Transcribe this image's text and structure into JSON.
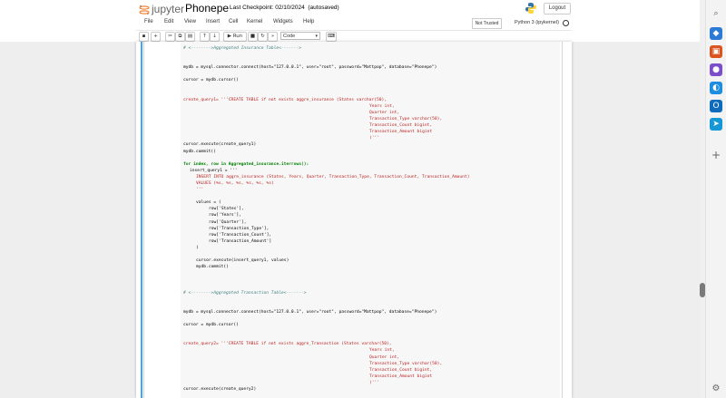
{
  "header": {
    "app_name": "jupyter",
    "notebook_title": "Phonepe",
    "checkpoint": "Last Checkpoint: 02/10/2024",
    "autosave": "(autosaved)",
    "logout_label": "Logout",
    "not_trusted_label": "Not Trusted",
    "kernel_label": "Python 3 (ipykernel)"
  },
  "menu": [
    "File",
    "Edit",
    "View",
    "Insert",
    "Cell",
    "Kernel",
    "Widgets",
    "Help"
  ],
  "toolbar": {
    "run_label": "Run",
    "cell_type": "Code",
    "buttons": [
      "save-icon",
      "add-cell-icon",
      "cut-icon",
      "copy-icon",
      "paste-icon",
      "move-up-icon",
      "move-down-icon",
      "run-icon",
      "stop-icon",
      "restart-icon",
      "restart-run-all-icon",
      "command-palette-icon"
    ]
  },
  "code": {
    "comment_insurance": "# <-------->Aggregated Insurance Table<------->",
    "mydb_connect_1": "mydb = mysql.connector.connect(host=\"127.0.0.1\", user=\"root\", password=\"Mattpop\", database=\"Phonepe\")",
    "cursor_1": "cursor = mydb.cursor()",
    "create_query1_open": "create_query1= '''CREATE TABLE if not exists aggre_insurance (States varchar(50),",
    "create_query1_years": "Years int,",
    "create_query1_quarter": "Quarter int,",
    "create_query1_type": "Transaction_Type varchar(50),",
    "create_query1_count": "Transaction_Count bigint,",
    "create_query1_amount": "Transaction_Amount bigint",
    "create_query1_close": ")'''",
    "execute_create1": "cursor.execute(create_query1)",
    "commit_1": "mydb.commit()",
    "for_loop": "for index, row in Aggregated_insurance.iterrows():",
    "insert_query_open": "insert_query1 = '''",
    "insert_into": "INSERT INTO aggre_insurance (States, Years, Quarter, Transaction_Type, Transaction_Count, Transaction_Amount)",
    "insert_values": "VALUES (%s, %s, %s, %s, %s, %s)",
    "insert_close": "'''",
    "values_open": "values = (",
    "row_states": "row['States'],",
    "row_years": "row['Years'],",
    "row_quarter": "row['Quarter'],",
    "row_type": "row['Transaction_Type'],",
    "row_count": "row['Transaction_Count'],",
    "row_amount": "row['Transaction_Amount']",
    "values_close": ")",
    "execute_insert": "cursor.execute(insert_query1, values)",
    "commit_loop": "mydb.commit()",
    "comment_transaction": "# <-------->Aggregated Transaction Table<------->",
    "mydb_connect_2": "mydb = mysql.connector.connect(host=\"127.0.0.1\", user=\"root\", password=\"Mattpop\", database=\"Phonepe\")",
    "cursor_2": "cursor = mydb.cursor()",
    "create_query2_open": "create_query2= '''CREATE TABLE if not exists aggre_Transaction (States varchar(50),",
    "create_query2_years": "Years int,",
    "create_query2_quarter": "Quarter int,",
    "create_query2_type": "Transaction_Type varchar(50),",
    "create_query2_count": "Transaction_Count bigint,",
    "create_query2_amount": "Transaction_Amount bigint",
    "create_query2_close": ")'''",
    "execute_create2": "cursor.execute(create_query2)"
  },
  "colors": {
    "cell_selected_bar": "#42a5f5",
    "comment": "#408080",
    "string": "#ba2121",
    "keyword": "#008000"
  },
  "sidebar_icons": [
    "search-icon",
    "tag-icon",
    "briefcase-icon",
    "people-icon",
    "copilot-icon",
    "outlook-icon",
    "send-icon",
    "add-icon",
    "settings-icon"
  ]
}
